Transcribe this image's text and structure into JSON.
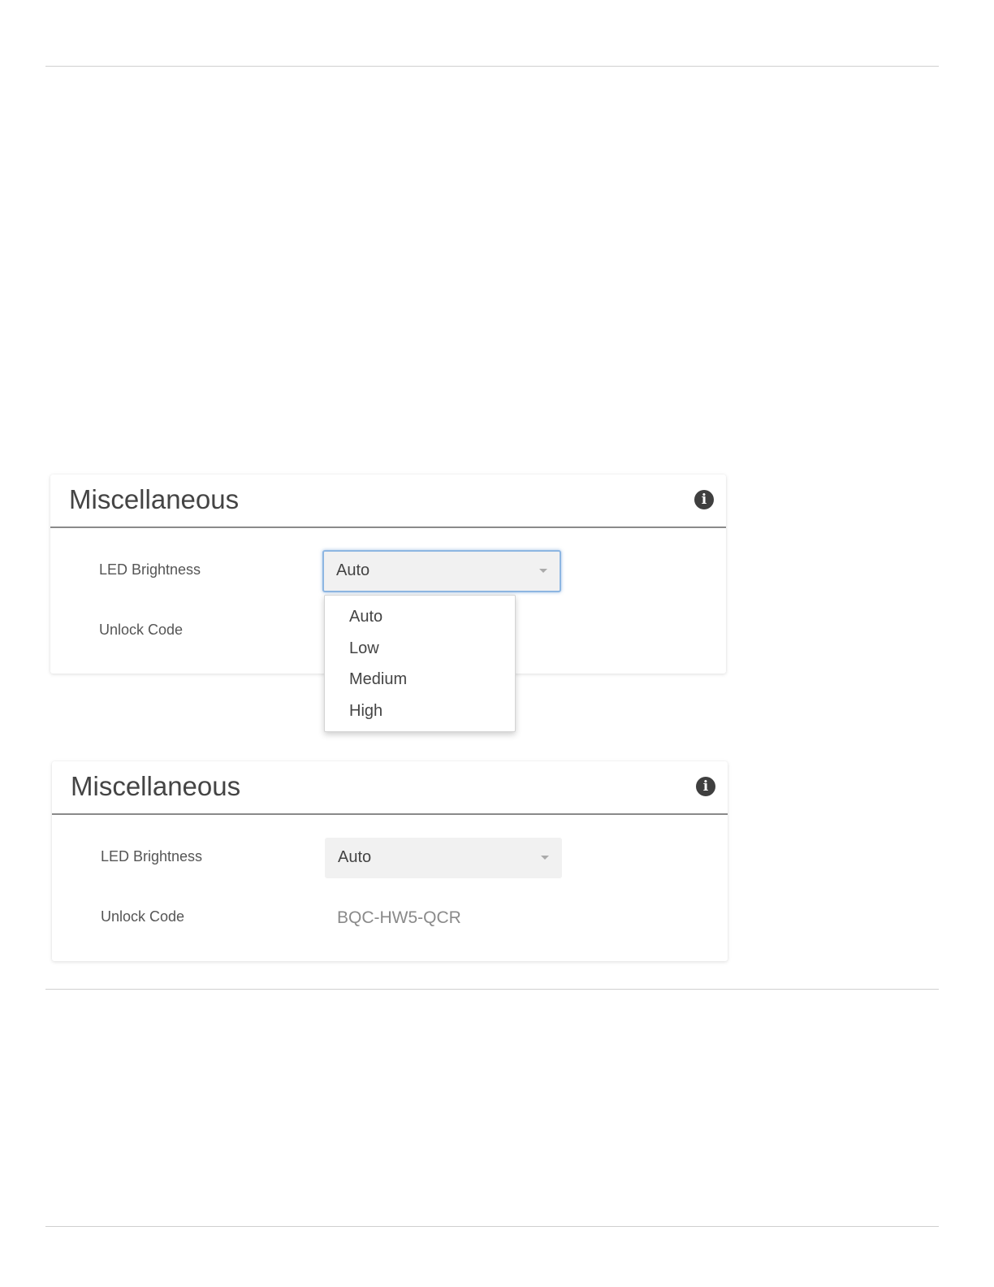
{
  "panel_top": {
    "title": "Miscellaneous",
    "info_icon": "info-icon",
    "led_label": "LED Brightness",
    "led_value": "Auto",
    "unlock_label": "Unlock Code",
    "dropdown_open": true,
    "options": [
      "Auto",
      "Low",
      "Medium",
      "High"
    ]
  },
  "panel_bottom": {
    "title": "Miscellaneous",
    "info_icon": "info-icon",
    "led_label": "LED Brightness",
    "led_value": "Auto",
    "unlock_label": "Unlock Code",
    "unlock_value": "BQC-HW5-QCR"
  },
  "colors": {
    "focus_border": "#8db6e2",
    "header_rule": "#8a8a8a",
    "select_bg": "#f1f1f1"
  }
}
